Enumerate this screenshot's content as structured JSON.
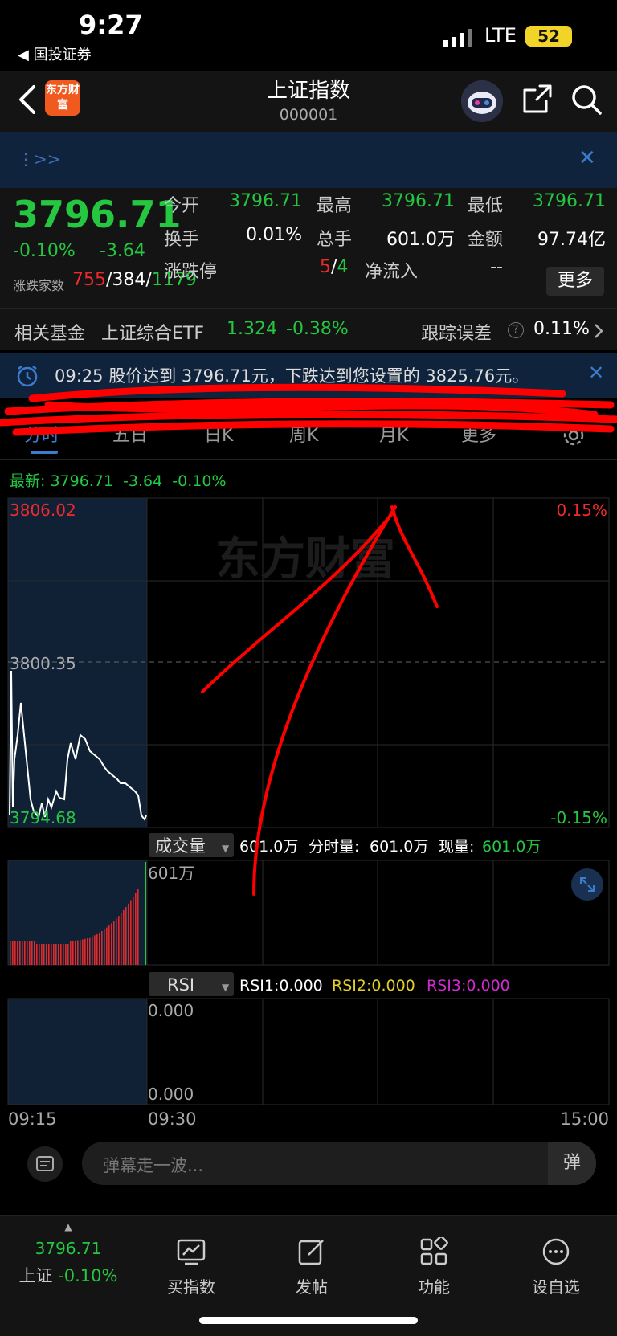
{
  "status_bar": {
    "time": "9:27",
    "back_app": "◀ 国投证券",
    "network": "LTE",
    "battery": "52"
  },
  "header": {
    "logo_text": "东方财富",
    "title": "上证指数",
    "code": "000001"
  },
  "banner": {
    "text": "⋮>>",
    "close": "✕"
  },
  "quote": {
    "price": "3796.71",
    "change_pct": "-0.10%",
    "change": "-3.64",
    "open_label": "今开",
    "open": "3796.71",
    "high_label": "最高",
    "high": "3796.71",
    "low_label": "最低",
    "low": "3796.71",
    "turnover_label": "换手",
    "turnover": "0.01%",
    "volume_label": "总手",
    "volume": "601.0万",
    "amount_label": "金额",
    "amount": "97.74亿",
    "breadth_label": "涨跌家数",
    "up_count": "755",
    "flat_count": "384",
    "down_count": "1179",
    "limit_label": "涨跌停",
    "limit_up": "5",
    "limit_down": "4",
    "netflow_label": "净流入",
    "netflow": "--",
    "more_button": "更多",
    "fund_label": "相关基金",
    "fund_name": "上证综合ETF",
    "fund_price": "1.324",
    "fund_pct": "-0.38%",
    "tracking_label": "跟踪误差",
    "tracking_value": "0.11%"
  },
  "alert": {
    "text": "09:25 股价达到 3796.71元，下跌达到您设置的 3825.76元。",
    "close": "✕"
  },
  "tabs": [
    "分时",
    "五日",
    "日K",
    "周K",
    "月K",
    "更多"
  ],
  "latest": {
    "label": "最新:",
    "price": "3796.71",
    "change": "-3.64",
    "pct": "-0.10%"
  },
  "chart": {
    "y_max": "3806.02",
    "y_mid": "3800.35",
    "y_min": "3794.68",
    "pct_max": "0.15%",
    "pct_min": "-0.15%",
    "watermark": "东方财富",
    "volume_selector": "成交量",
    "volume_summary": "601.0万",
    "period_volume_label": "分时量:",
    "period_volume": "601.0万",
    "current_volume_label": "现量:",
    "current_volume": "601.0万",
    "volume_max_label": "601万",
    "rsi_selector": "RSI",
    "rsi1": "RSI1:0.000",
    "rsi2": "RSI2:0.000",
    "rsi3": "RSI3:0.000",
    "rsi_top": "0.000",
    "rsi_bottom": "0.000",
    "time_start": "09:15",
    "time_open": "09:30",
    "time_end": "15:00",
    "colors": {
      "up": "#f02a2a",
      "down": "#25c640",
      "accent": "#3b7cd0"
    }
  },
  "danmu": {
    "placeholder": "弹幕走一波...",
    "send": "弹"
  },
  "navbar": {
    "index_price": "3796.71",
    "index_name": "上证",
    "index_pct": "-0.10%",
    "items": [
      "买指数",
      "发帖",
      "功能",
      "设自选"
    ]
  }
}
